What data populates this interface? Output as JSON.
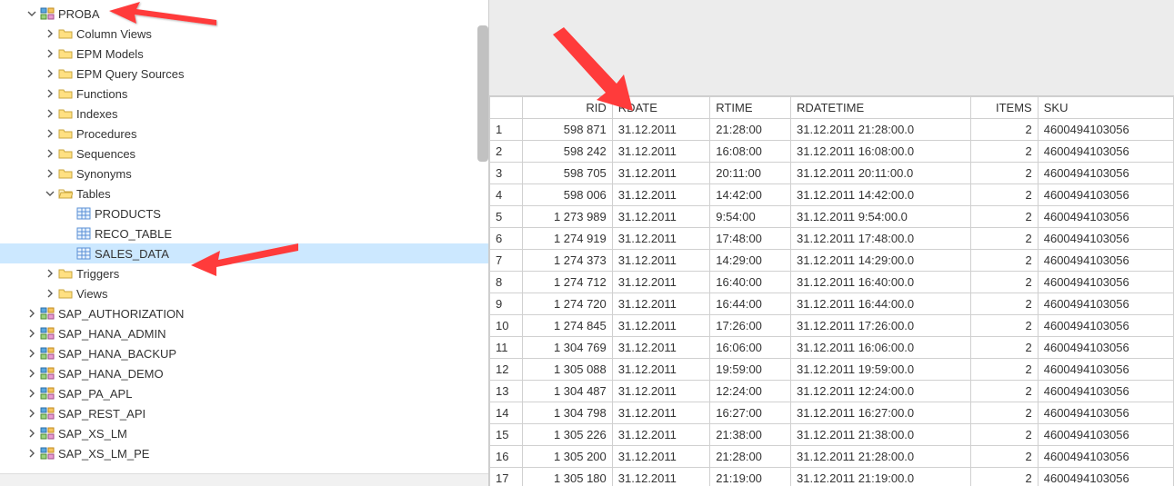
{
  "tree": {
    "root_schema": "PROBA",
    "folders": [
      "Column Views",
      "EPM Models",
      "EPM Query Sources",
      "Functions",
      "Indexes",
      "Procedures",
      "Sequences",
      "Synonyms"
    ],
    "tables_label": "Tables",
    "tables": [
      "PRODUCTS",
      "RECO_TABLE",
      "SALES_DATA"
    ],
    "after_tables": [
      "Triggers",
      "Views"
    ],
    "other_schemas": [
      "SAP_AUTHORIZATION",
      "SAP_HANA_ADMIN",
      "SAP_HANA_BACKUP",
      "SAP_HANA_DEMO",
      "SAP_PA_APL",
      "SAP_REST_API",
      "SAP_XS_LM",
      "SAP_XS_LM_PE"
    ],
    "selected_table": "SALES_DATA"
  },
  "grid": {
    "columns": [
      "RID",
      "RDATE",
      "RTIME",
      "RDATETIME",
      "ITEMS",
      "SKU"
    ],
    "align": [
      "num",
      "left",
      "left",
      "left",
      "num",
      "left"
    ],
    "rows": [
      [
        "598 871",
        "31.12.2011",
        "21:28:00",
        "31.12.2011 21:28:00.0",
        "2",
        "4600494103056"
      ],
      [
        "598 242",
        "31.12.2011",
        "16:08:00",
        "31.12.2011 16:08:00.0",
        "2",
        "4600494103056"
      ],
      [
        "598 705",
        "31.12.2011",
        "20:11:00",
        "31.12.2011 20:11:00.0",
        "2",
        "4600494103056"
      ],
      [
        "598 006",
        "31.12.2011",
        "14:42:00",
        "31.12.2011 14:42:00.0",
        "2",
        "4600494103056"
      ],
      [
        "1 273 989",
        "31.12.2011",
        "9:54:00",
        "31.12.2011 9:54:00.0",
        "2",
        "4600494103056"
      ],
      [
        "1 274 919",
        "31.12.2011",
        "17:48:00",
        "31.12.2011 17:48:00.0",
        "2",
        "4600494103056"
      ],
      [
        "1 274 373",
        "31.12.2011",
        "14:29:00",
        "31.12.2011 14:29:00.0",
        "2",
        "4600494103056"
      ],
      [
        "1 274 712",
        "31.12.2011",
        "16:40:00",
        "31.12.2011 16:40:00.0",
        "2",
        "4600494103056"
      ],
      [
        "1 274 720",
        "31.12.2011",
        "16:44:00",
        "31.12.2011 16:44:00.0",
        "2",
        "4600494103056"
      ],
      [
        "1 274 845",
        "31.12.2011",
        "17:26:00",
        "31.12.2011 17:26:00.0",
        "2",
        "4600494103056"
      ],
      [
        "1 304 769",
        "31.12.2011",
        "16:06:00",
        "31.12.2011 16:06:00.0",
        "2",
        "4600494103056"
      ],
      [
        "1 305 088",
        "31.12.2011",
        "19:59:00",
        "31.12.2011 19:59:00.0",
        "2",
        "4600494103056"
      ],
      [
        "1 304 487",
        "31.12.2011",
        "12:24:00",
        "31.12.2011 12:24:00.0",
        "2",
        "4600494103056"
      ],
      [
        "1 304 798",
        "31.12.2011",
        "16:27:00",
        "31.12.2011 16:27:00.0",
        "2",
        "4600494103056"
      ],
      [
        "1 305 226",
        "31.12.2011",
        "21:38:00",
        "31.12.2011 21:38:00.0",
        "2",
        "4600494103056"
      ],
      [
        "1 305 200",
        "31.12.2011",
        "21:28:00",
        "31.12.2011 21:28:00.0",
        "2",
        "4600494103056"
      ],
      [
        "1 305 180",
        "31.12.2011",
        "21:19:00",
        "31.12.2011 21:19:00.0",
        "2",
        "4600494103056"
      ]
    ]
  }
}
